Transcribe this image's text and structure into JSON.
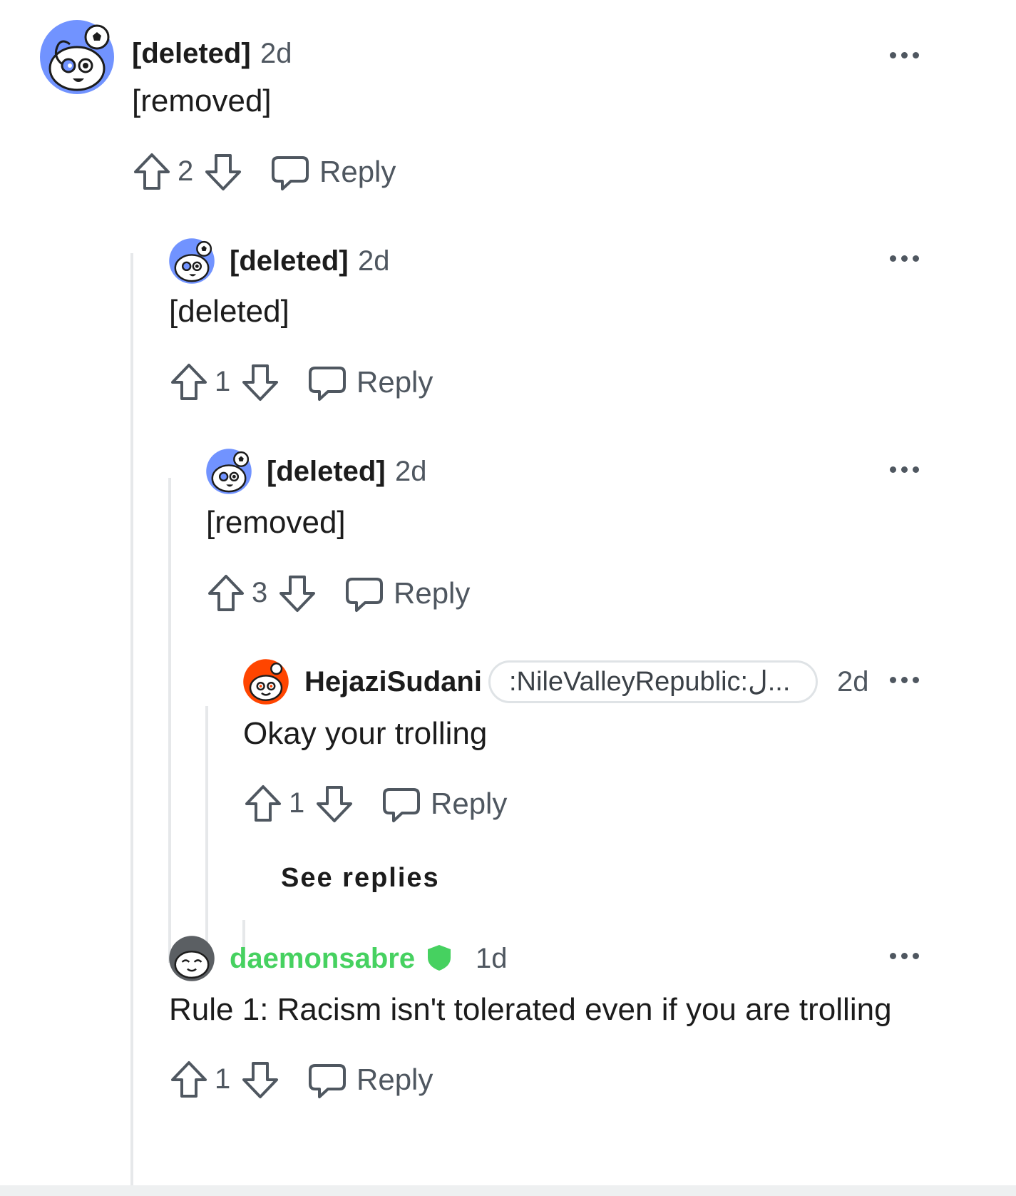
{
  "comments": [
    {
      "author": "[deleted]",
      "time": "2d",
      "body": "[removed]",
      "score": "2",
      "reply_label": "Reply",
      "avatar": "snoo-soccer-icon"
    },
    {
      "author": "[deleted]",
      "time": "2d",
      "body": "[deleted]",
      "score": "1",
      "reply_label": "Reply",
      "avatar": "snoo-soccer-icon"
    },
    {
      "author": "[deleted]",
      "time": "2d",
      "body": "[removed]",
      "score": "3",
      "reply_label": "Reply",
      "avatar": "snoo-soccer-icon"
    },
    {
      "author": "HejaziSudani",
      "flair": ":NileValleyRepublic:ل...",
      "time": "2d",
      "body": "Okay your trolling",
      "score": "1",
      "reply_label": "Reply",
      "avatar": "snoo-orange-icon"
    },
    {
      "author": "daemonsabre",
      "time": "1d",
      "body": "Rule 1: Racism isn't tolerated even if you are trolling",
      "score": "1",
      "reply_label": "Reply",
      "avatar": "snoo-gray-icon",
      "author_color": "#46d160",
      "mod_badge": "mod-shield-icon"
    }
  ],
  "see_replies_label": "See replies",
  "colors": {
    "accent_green": "#46d160",
    "avatar_blue": "#7193ff",
    "avatar_orange": "#ff4500",
    "meta_gray": "#4f5760"
  }
}
